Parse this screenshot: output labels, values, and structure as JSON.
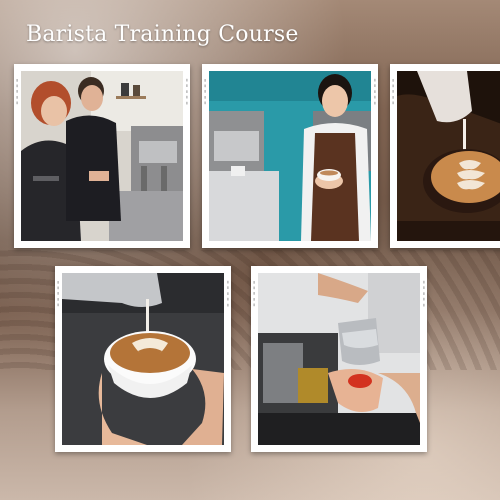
{
  "title": "Barista Training Course"
}
